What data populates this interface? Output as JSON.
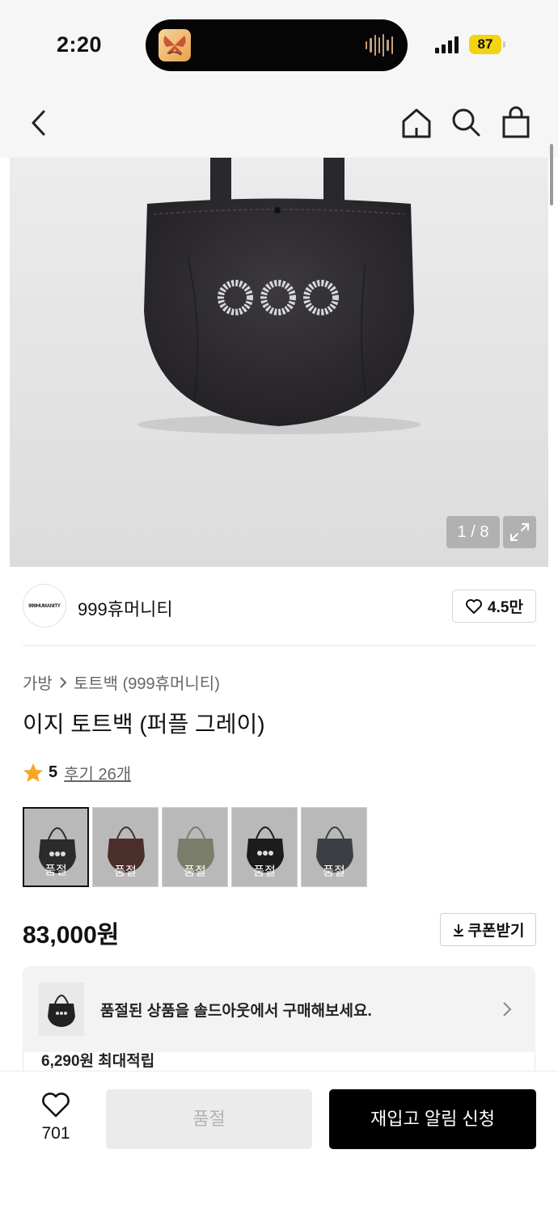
{
  "status_bar": {
    "time": "2:20",
    "battery": "87"
  },
  "nav": {
    "back_icon": "chevron-left-icon",
    "home_icon": "home-icon",
    "search_icon": "search-icon",
    "bag_icon": "shopping-bag-icon"
  },
  "gallery": {
    "counter": "1 / 8",
    "expand_icon": "expand-icon"
  },
  "brand": {
    "logo_text": "999HUMANITY",
    "name": "999휴머니티",
    "likes": "4.5만"
  },
  "product": {
    "breadcrumb": [
      "가방",
      "토트백 (999휴머니티)"
    ],
    "title": "이지 토트백 (퍼플 그레이)",
    "rating": "5",
    "reviews": "후기 26개",
    "options": [
      {
        "label": "품절",
        "color": "#2b2a2d"
      },
      {
        "label": "품절",
        "color": "#4a2e2a"
      },
      {
        "label": "품절",
        "color": "#7a7d6a"
      },
      {
        "label": "품절",
        "color": "#1c1c1c"
      },
      {
        "label": "품절",
        "color": "#3b3e42"
      }
    ],
    "price": "83,000원",
    "coupon_button": "쿠폰받기"
  },
  "banner": {
    "text": "품절된 상품을 솔드아웃에서 구매해보세요."
  },
  "points": {
    "text": "6,290원 최대적립"
  },
  "bottom_bar": {
    "wish_count": "701",
    "soldout_button": "품절",
    "notify_button": "재입고 알림 신청"
  },
  "colors": {
    "accent": "#000000",
    "star": "#f5a623",
    "battery": "#f3d313"
  }
}
